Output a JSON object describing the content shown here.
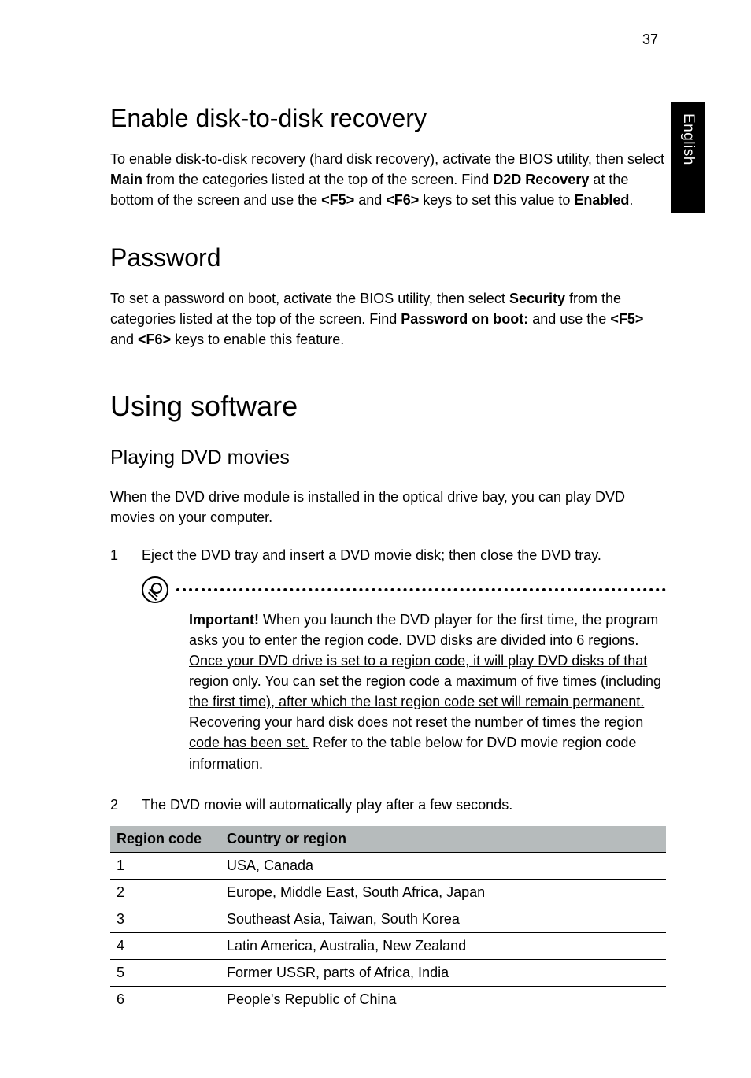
{
  "page_number": "37",
  "sidetab": "English",
  "sec1": {
    "title": "Enable disk-to-disk recovery",
    "p_a": "To enable disk-to-disk recovery (hard disk recovery), activate the BIOS utility, then select ",
    "p_b": "Main",
    "p_c": " from the categories listed at the top of the screen. Find ",
    "p_d": "D2D Recovery",
    "p_e": " at the bottom of the screen and use the ",
    "p_f": "<F5>",
    "p_g": " and ",
    "p_h": "<F6>",
    "p_i": " keys to set this value to ",
    "p_j": "Enabled",
    "p_k": "."
  },
  "sec2": {
    "title": "Password",
    "p_a": "To set a password on boot, activate the BIOS utility, then select ",
    "p_b": "Security",
    "p_c": " from the categories listed at the top of the screen. Find ",
    "p_d": "Password on boot:",
    "p_e": " and use the ",
    "p_f": "<F5>",
    "p_g": " and ",
    "p_h": "<F6>",
    "p_i": " keys to enable this feature."
  },
  "sec3": {
    "title": "Using software",
    "sub": "Playing DVD movies",
    "p1": "When the DVD drive module is installed in the optical drive bay, you can play DVD movies on your computer.",
    "step1_num": "1",
    "step1_txt": "Eject the DVD tray and insert a DVD movie disk; then close the DVD tray.",
    "callout": {
      "b1": "Important!",
      "a": " When you launch the DVD player for the first time, the program asks you to enter the region code. DVD disks are divided into 6 regions. ",
      "u1": "Once your DVD drive is set to a region code, it will play DVD disks of that region only. You can set the region code a maximum of five times (including the first time), after which the last region code set will remain permanent. Recovering your hard disk does not reset the number of times the region code has been set.",
      "b": " Refer to the table below for DVD movie region code information."
    },
    "step2_num": "2",
    "step2_txt": "The DVD movie will automatically play after a few seconds."
  },
  "table": {
    "h1": "Region code",
    "h2": "Country or region",
    "rows": [
      {
        "code": "1",
        "region": "USA, Canada"
      },
      {
        "code": "2",
        "region": "Europe, Middle East, South Africa, Japan"
      },
      {
        "code": "3",
        "region": "Southeast Asia, Taiwan, South Korea"
      },
      {
        "code": "4",
        "region": "Latin America, Australia, New Zealand"
      },
      {
        "code": "5",
        "region": "Former USSR, parts of Africa, India"
      },
      {
        "code": "6",
        "region": "People's Republic of China"
      }
    ]
  }
}
